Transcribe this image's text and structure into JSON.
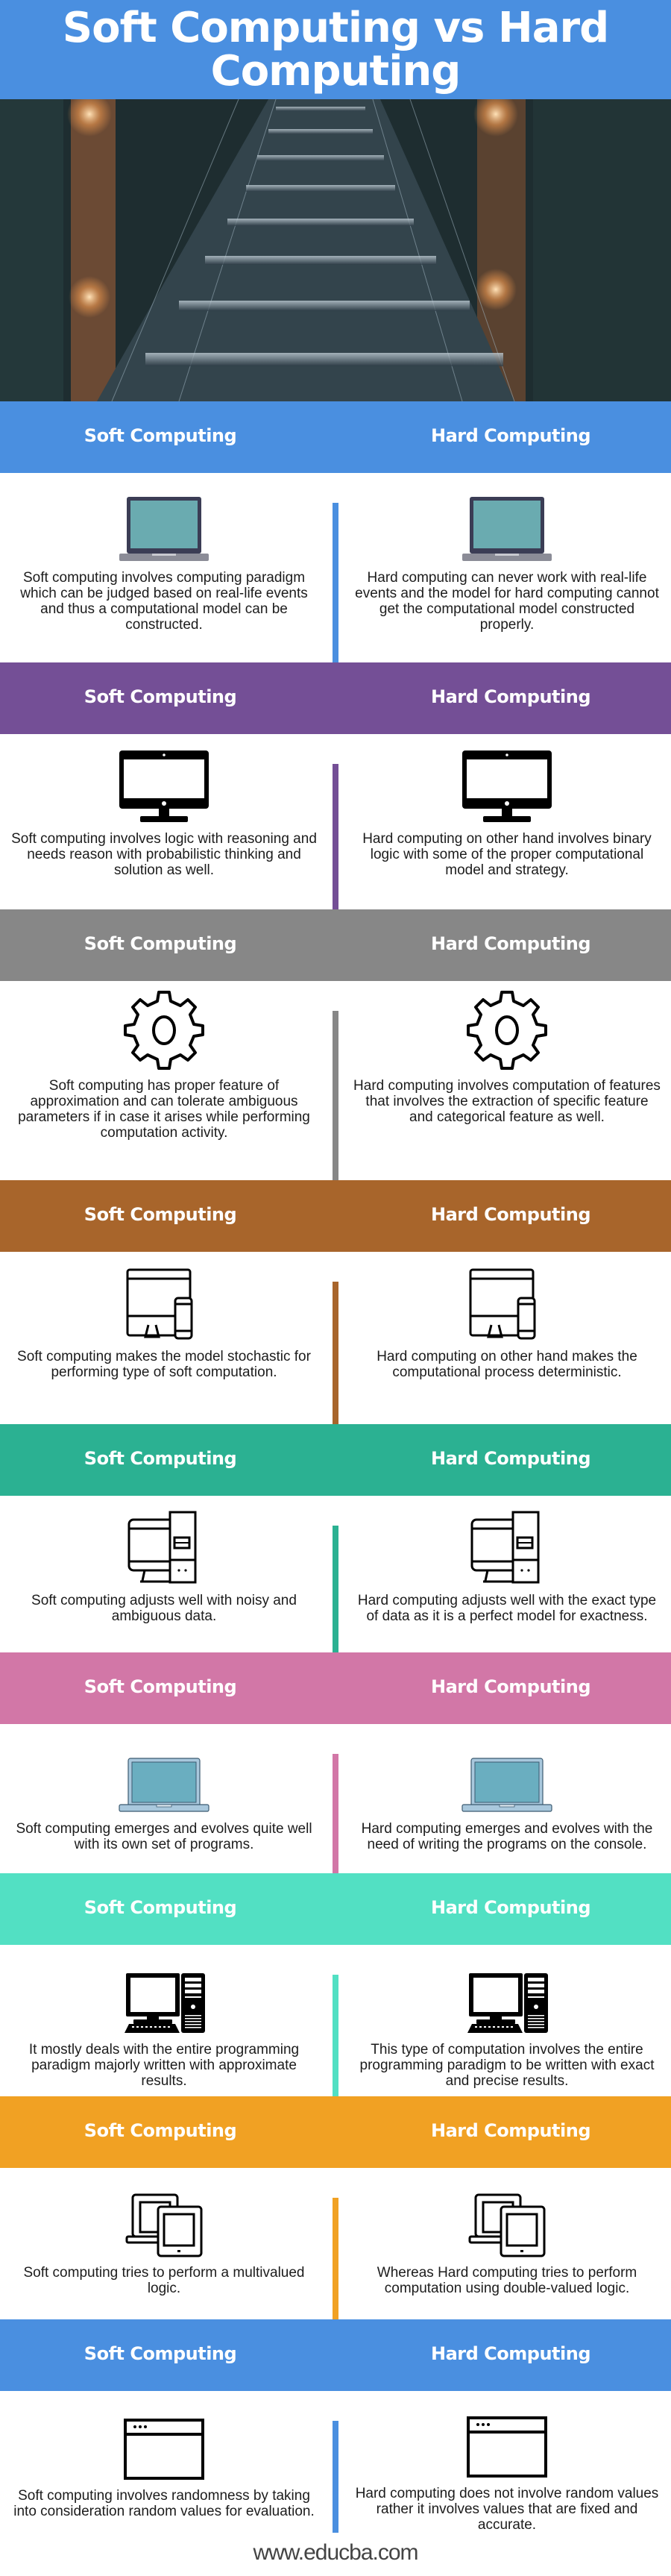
{
  "title": "Soft Computing vs Hard Computing",
  "hero": {
    "image": "server-room-walkway-photo"
  },
  "column_headers": {
    "left": "Soft Computing",
    "right": "Hard Computing"
  },
  "sections": [
    {
      "color": "#4a8fe0",
      "icon": "laptop-icon",
      "soft": "Soft computing involves computing paradigm which can be judged based on real-life events and thus a computational model can be constructed.",
      "hard": "Hard computing can never work with real-life events and the model for hard computing cannot get the computational model constructed properly."
    },
    {
      "color": "#744f96",
      "icon": "monitor-icon",
      "soft": "Soft computing involves logic with reasoning and needs reason with probabilistic thinking and solution as well.",
      "hard": "Hard computing on other hand involves binary logic with some of the proper computational model and strategy."
    },
    {
      "color": "#878787",
      "icon": "gear-icon",
      "soft": "Soft computing has proper feature of approximation and can tolerate ambiguous parameters if in case it arises while performing computation activity.",
      "hard": "Hard computing involves computation of features that involves the extraction of specific feature and categorical feature as well."
    },
    {
      "color": "#a8652b",
      "icon": "desktop-and-phone-icon",
      "soft": "Soft computing makes the model stochastic for performing type of soft computation.",
      "hard": "Hard computing on other hand makes the computational process deterministic."
    },
    {
      "color": "#2bb192",
      "icon": "computer-tower-icon",
      "soft": "Soft computing adjusts well with noisy and ambiguous data.",
      "hard": "Hard computing adjusts well with the exact type of data as it is a perfect model for exactness."
    },
    {
      "color": "#d277a7",
      "icon": "laptop-light-icon",
      "soft": "Soft computing emerges and evolves quite well with its own set of programs.",
      "hard": "Hard computing emerges and evolves with the need of writing the programs on the console."
    },
    {
      "color": "#52e0c3",
      "icon": "desktop-pc-icon",
      "soft": "It mostly deals with the entire programming paradigm majorly written with approximate results.",
      "hard": "This type of computation involves the entire programming paradigm to be written with exact and precise results."
    },
    {
      "color": "#f1a123",
      "icon": "laptop-and-tablet-icon",
      "soft": "Soft computing tries to perform a multivalued logic.",
      "hard": "Whereas Hard computing tries to perform computation using double-valued logic."
    },
    {
      "color": "#4a8fe0",
      "icon": "browser-window-icon",
      "soft": "Soft computing involves randomness by taking into consideration random values for evaluation.",
      "hard": "Hard computing does not involve random values rather it involves values that are fixed and accurate."
    }
  ],
  "footer": "www.educba.com"
}
